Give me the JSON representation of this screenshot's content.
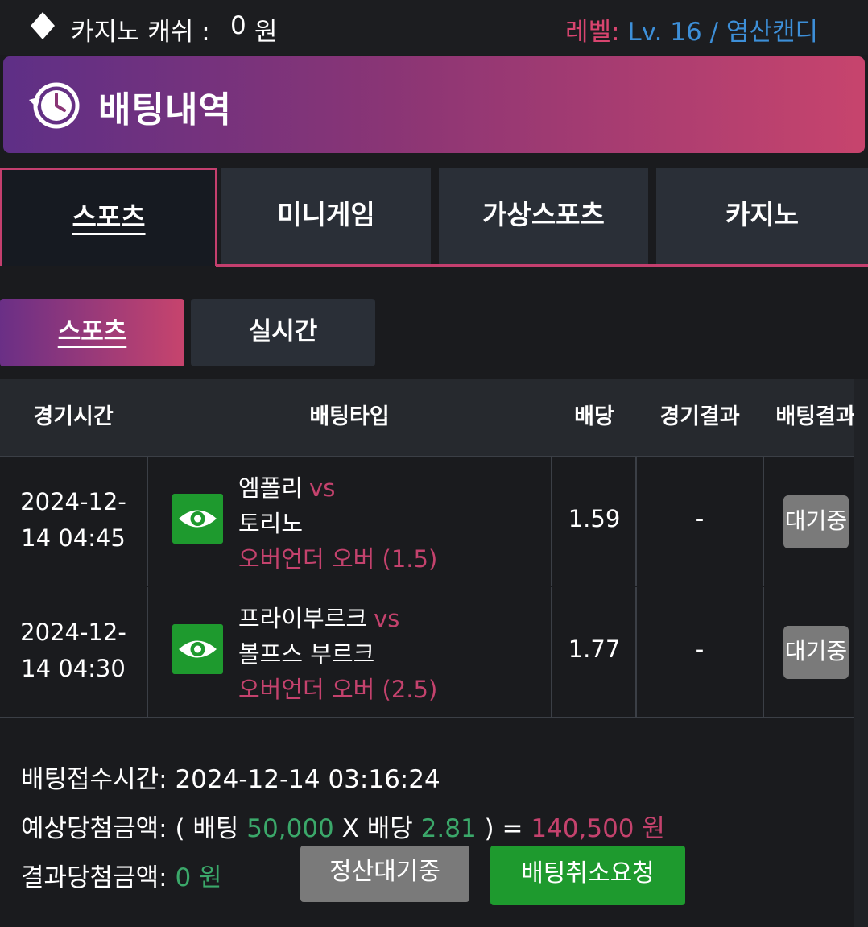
{
  "topbar": {
    "cash_label": "카지노 캐쉬 :",
    "cash_value": "0",
    "cash_unit": "원",
    "level_label": "레벨:",
    "level_value": "Lv. 16 / 염산캔디"
  },
  "header": {
    "title": "배팅내역",
    "icon": "history-clock-icon"
  },
  "tabs": [
    {
      "label": "스포츠",
      "active": true
    },
    {
      "label": "미니게임",
      "active": false
    },
    {
      "label": "가상스포츠",
      "active": false
    },
    {
      "label": "카지노",
      "active": false
    }
  ],
  "subtabs": [
    {
      "label": "스포츠",
      "active": true
    },
    {
      "label": "실시간",
      "active": false
    }
  ],
  "table": {
    "headers": [
      "경기시간",
      "배팅타입",
      "배당",
      "경기결과",
      "배팅결과"
    ],
    "rows": [
      {
        "time_line1": "2024-12-",
        "time_line2": "14 04:45",
        "home": "엠폴리",
        "vs": "vs",
        "away": "토리노",
        "bet_type": "오버언더 오버 (1.5)",
        "odds": "1.59",
        "game_result": "-",
        "bet_result": "대기중"
      },
      {
        "time_line1": "2024-12-",
        "time_line2": "14 04:30",
        "home": "프라이부르크",
        "vs": "vs",
        "away": "볼프스 부르크",
        "bet_type": "오버언더 오버 (2.5)",
        "odds": "1.77",
        "game_result": "-",
        "bet_result": "대기중"
      }
    ]
  },
  "summary": {
    "received_label": "배팅접수시간:",
    "received_time": "2024-12-14 03:16:24",
    "expected_label": "예상당첨금액:",
    "open_paren": "( 배팅",
    "bet_amount": "50,000",
    "x_odds": "X 배당",
    "total_odds": "2.81",
    "close_eq": ") =",
    "expected_amount": "140,500 원",
    "result_label": "결과당첨금액:",
    "result_amount": "0 원",
    "pending_button": "정산대기중",
    "cancel_button": "배팅취소요청"
  },
  "colors": {
    "accent_pink": "#c4426d",
    "accent_green": "#1e9a2e",
    "level_blue": "#3d8fd8"
  }
}
